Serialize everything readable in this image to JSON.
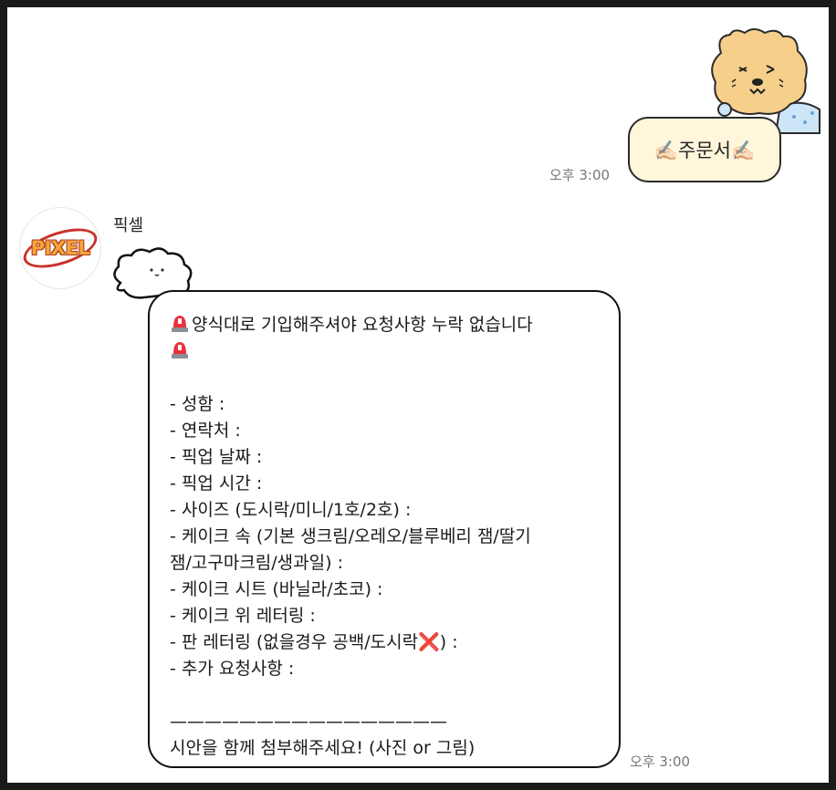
{
  "outgoing": {
    "text": "✍🏻주문서✍🏻",
    "time": "오후 3:00"
  },
  "incoming": {
    "sender": "픽셀",
    "avatar_logo": "PIXEL",
    "time": "오후 3:00",
    "lines": [
      {
        "text": "양식대로 기입해주셔야 요청사항 누락 없습니다",
        "icon": "siren-icon"
      },
      {
        "text": "",
        "icon": "siren-icon"
      },
      {
        "text": ""
      },
      {
        "text": "- 성함 :"
      },
      {
        "text": "- 연락처 :"
      },
      {
        "text": "- 픽업 날짜 :"
      },
      {
        "text": "- 픽업 시간 :"
      },
      {
        "text": "- 사이즈 (도시락/미니/1호/2호) :"
      },
      {
        "text": "- 케이크 속 (기본 생크림/오레오/블루베리 잼/딸기"
      },
      {
        "text": "잼/고구마크림/생과일) :"
      },
      {
        "text": "- 케이크 시트 (바닐라/초코) :"
      },
      {
        "text": "- 케이크 위 레터링 :"
      },
      {
        "text": "- 판 레터링 (없을경우 공백/도시락",
        "suffix_icon": "cross-mark-icon",
        "suffix": ") :"
      },
      {
        "text": "- 추가 요청사항 :"
      },
      {
        "text": ""
      },
      {
        "text": "————————————————"
      },
      {
        "text": "시안을 함께 첨부해주세요! (사진 or  그림)"
      }
    ]
  }
}
